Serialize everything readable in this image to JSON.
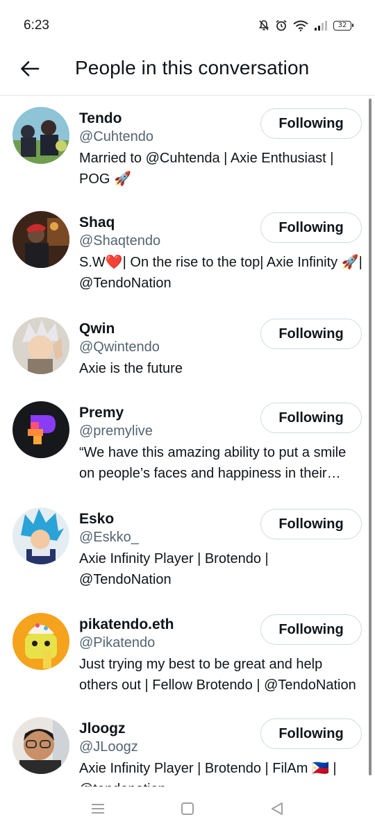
{
  "status_bar": {
    "time": "6:23",
    "battery_level": "32",
    "icons": [
      "mute-bell-icon",
      "alarm-icon",
      "wifi-icon",
      "signal-icon",
      "battery-icon"
    ]
  },
  "header": {
    "back_icon": "arrow-left-icon",
    "title": "People in this conversation"
  },
  "people": [
    {
      "name": "Tendo",
      "handle": "@Cuhtendo",
      "bio": "Married to @Cuhtenda | Axie Enthusiast | POG 🚀",
      "button": "Following"
    },
    {
      "name": "Shaq",
      "handle": "@Shaqtendo",
      "bio": "S.W❤️| On the rise to the top| Axie Infinity 🚀| @TendoNation",
      "button": "Following"
    },
    {
      "name": "Qwin",
      "handle": "@Qwintendo",
      "bio": "Axie is the future",
      "button": "Following"
    },
    {
      "name": "Premy",
      "handle": "@premylive",
      "bio": "“We have this amazing ability to put a smile on people’s faces and happiness in their hearts”",
      "button": "Following"
    },
    {
      "name": "Esko",
      "handle": "@Eskko_",
      "bio": "Axie Infinity Player | Brotendo | @TendoNation",
      "button": "Following"
    },
    {
      "name": "pikatendo.eth",
      "handle": "@Pikatendo",
      "bio": "Just trying my best to be great and help others out | Fellow Brotendo | @TendoNation",
      "button": "Following"
    },
    {
      "name": "Jloogz",
      "handle": "@JLoogz",
      "bio": "Axie Infinity Player | Brotendo | FilAm 🇵🇭 | @tendonation",
      "button": "Following"
    }
  ],
  "nav_bar": {
    "icons": [
      "menu-icon",
      "home-square-icon",
      "back-triangle-icon"
    ]
  }
}
